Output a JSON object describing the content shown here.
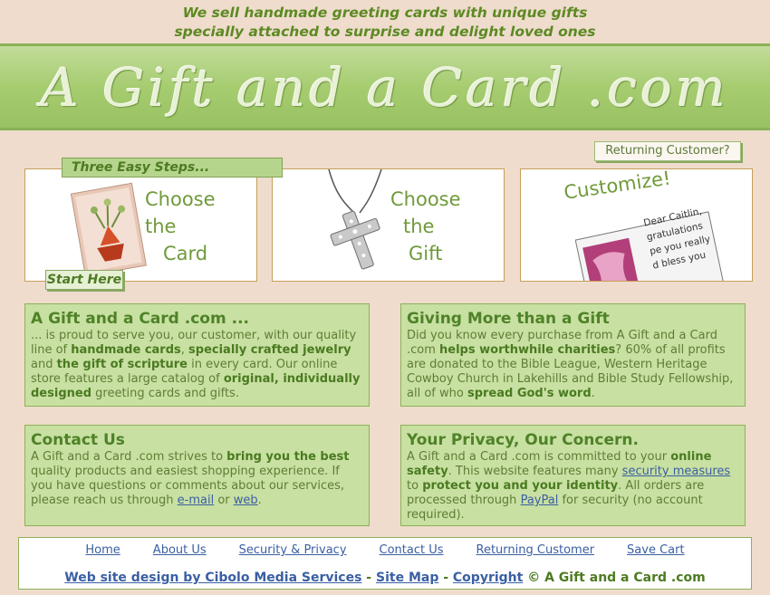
{
  "header": {
    "tagline_line1": "We sell handmade greeting cards with unique gifts",
    "tagline_line2": "specially attached to surprise and delight loved ones",
    "logo_text": "A Gift and a Card .com"
  },
  "returning_customer_button": "Returning Customer?",
  "steps": {
    "heading": "Three Easy Steps...",
    "start_here": "Start Here",
    "step1": [
      "Choose",
      "the",
      "Card"
    ],
    "step2": [
      "Choose",
      "the",
      "Gift"
    ],
    "step3": "Customize!",
    "step3_card_lines": [
      "Dear Caitlin,",
      "gratulations",
      "pe you really",
      "d bless you"
    ]
  },
  "about": {
    "title": "A Gift and a Card .com ...",
    "t1": "... is proud to serve you, our customer, with our quality line of ",
    "b1": "handmade cards",
    "t2": ", ",
    "b2": "specially crafted jewelry",
    "t3": " and ",
    "b3": "the gift of scripture",
    "t4": " in every card. Our online store features a large catalog of ",
    "b4": "original, individually designed",
    "t5": " greeting cards and gifts."
  },
  "giving": {
    "title": "Giving More than a Gift",
    "t1": "Did you know every purchase from A Gift and a Card .com ",
    "b1": "helps worthwhile charities",
    "t2": "? 60% of all profits are donated to the Bible League, Western Heritage Cowboy Church in Lakehills and Bible Study Fellowship, all of who ",
    "b2": "spread God's word",
    "t3": "."
  },
  "contact": {
    "title": "Contact Us",
    "t1": "A Gift and a Card .com strives to ",
    "b1": "bring you the best",
    "t2": " quality products and easiest shopping experience. If you have questions or comments about our services, please reach us through ",
    "link1": "e-mail",
    "t3": " or ",
    "link2": "web",
    "t4": "."
  },
  "privacy": {
    "title": "Your Privacy, Our Concern.",
    "t1": "A Gift and a Card .com is committed to your ",
    "b1": "online safety",
    "t2": ". This website features many ",
    "link1": "security measures",
    "t3": " to ",
    "b2": "protect you and your identity",
    "t4": ". All orders are processed through ",
    "link2": "PayPal",
    "t5": " for security (no account required)."
  },
  "footer": {
    "nav": [
      "Home",
      "About Us",
      "Security & Privacy",
      "Contact Us",
      "Returning Customer",
      "Save Cart"
    ],
    "design_credit": "Web site design by Cibolo Media Services",
    "sep1": " - ",
    "site_map": "Site Map",
    "sep2": " - ",
    "copyright": "Copyright",
    "copyright_tail": " © A Gift and a Card .com"
  },
  "colors": {
    "background": "#efdccd",
    "accent_green": "#5c8a22",
    "box_green": "#c8e0a2",
    "link_blue": "#3a5fa3"
  }
}
